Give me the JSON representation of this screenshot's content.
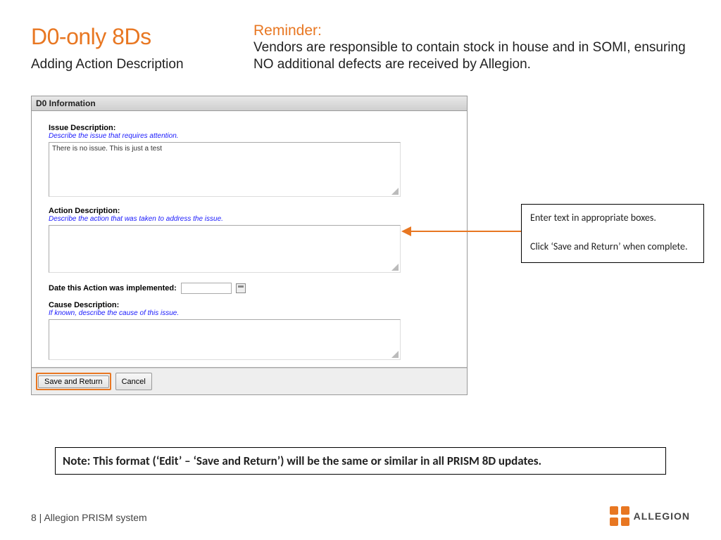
{
  "header": {
    "title": "D0-only 8Ds",
    "subtitle": "Adding Action Description"
  },
  "reminder": {
    "label": "Reminder:",
    "text": "Vendors are responsible to contain stock in house and in SOMI, ensuring NO additional defects are received by Allegion."
  },
  "window": {
    "title": "D0 Information",
    "issue_label": "Issue Description:",
    "issue_hint": "Describe the issue that requires attention.",
    "issue_value": "There is no issue.  This is just a test",
    "action_label": "Action Description:",
    "action_hint": "Describe the action that was taken to address the issue.",
    "action_value": "",
    "date_label": "Date this Action was implemented:",
    "date_value": "",
    "cause_label": "Cause Description:",
    "cause_hint": "If known, describe the cause of this issue.",
    "cause_value": "",
    "save_label": "Save and Return",
    "cancel_label": "Cancel"
  },
  "callout": {
    "line1": "Enter text in appropriate boxes.",
    "line2": "Click ‘Save and Return’ when complete."
  },
  "note": "Note: This format  (‘Edit’ – ‘Save and Return’)  will be the same or similar in all PRISM 8D updates.",
  "footer": {
    "page": "8",
    "sep": " | ",
    "system": "Allegion PRISM system"
  },
  "logo": {
    "text": "ALLEGION"
  }
}
